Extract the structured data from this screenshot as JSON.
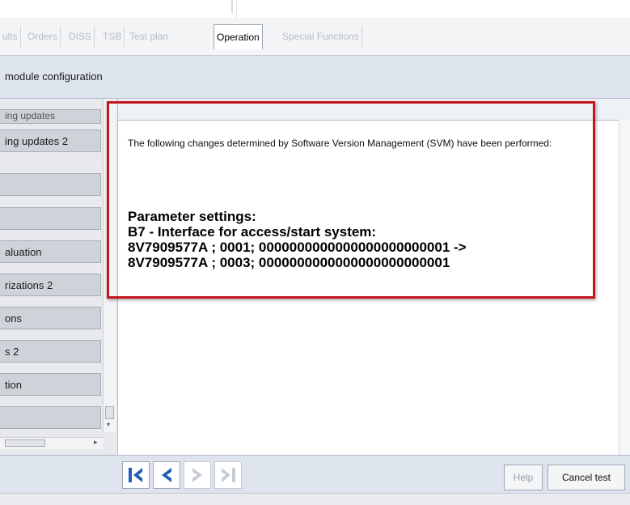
{
  "tabs": [
    {
      "label": "ults",
      "active": false
    },
    {
      "label": "Orders",
      "active": false
    },
    {
      "label": "DISS",
      "active": false
    },
    {
      "label": "TSB",
      "active": false
    },
    {
      "label": "Test plan",
      "active": false
    },
    {
      "label": "Operation",
      "active": true
    },
    {
      "label": "Special Functions",
      "active": false
    }
  ],
  "header": {
    "title": "module configuration"
  },
  "sidebar": {
    "items": [
      {
        "label": "ing updates"
      },
      {
        "label": "ing updates 2"
      },
      {
        "label": ""
      },
      {
        "label": ""
      },
      {
        "label": "aluation"
      },
      {
        "label": "rizations 2"
      },
      {
        "label": "ons"
      },
      {
        "label": "s 2"
      },
      {
        "label": "tion"
      },
      {
        "label": ""
      }
    ]
  },
  "content": {
    "message": "The following changes determined by Software Version Management (SVM) have been performed:",
    "params": {
      "heading": "Parameter settings:",
      "line1": "B7 - Interface for access/start system:",
      "line2": "8V7909577A ; 0001; 0000000000000000000000001 ->",
      "line3": "8V7909577A ; 0003; 0000000000000000000000001"
    }
  },
  "footer": {
    "help_label": "Help",
    "cancel_label": "Cancel test"
  },
  "icons": {
    "first": "first-page-icon",
    "back": "back-icon",
    "forward": "forward-icon",
    "last": "last-page-icon"
  },
  "colors": {
    "highlight": "#c0181e",
    "nav_enabled": "#1f5fb8",
    "nav_disabled": "#c7ccd4"
  }
}
